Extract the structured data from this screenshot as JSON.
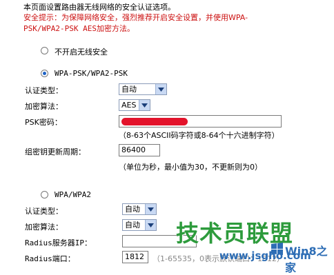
{
  "intro_line": "本页面设置路由器无线网络的安全认证选项。",
  "warning_line1": "安全提示：为保障网络安全，强烈推荐开启安全设置，并使用WPA-",
  "warning_line2": "PSK/WPA2-PSK AES加密方法。",
  "options": {
    "no_security": "不开启无线安全",
    "wpa_psk": "WPA-PSK/WPA2-PSK",
    "wpa": "WPA/WPA2"
  },
  "psk_section": {
    "auth_type_label": "认证类型：",
    "auth_type_value": "自动",
    "encryption_label": "加密算法：",
    "encryption_value": "AES",
    "psk_password_label": "PSK密码：",
    "psk_hint": "（8-63个ASCII码字符或8-64个十六进制字符）",
    "group_key_label": "组密钥更新周期：",
    "group_key_value": "86400",
    "group_key_hint": "（单位为秒，最小值为30，不更新则为0）"
  },
  "wpa_section": {
    "auth_type_label": "认证类型：",
    "auth_type_value": "自动",
    "encryption_label": "加密算法：",
    "encryption_value": "自动",
    "radius_ip_label": "Radius服务器IP：",
    "radius_port_label": "Radius端口：",
    "radius_port_value": "1812",
    "radius_port_hint": "（1-65535，0表示默认端口：1812）"
  },
  "watermark": {
    "big_text": "技术员联盟",
    "site_a": "Win8之家",
    "site_b": "www.jsgho.com"
  },
  "colors": {
    "warning": "#cc1010",
    "radio_selected": "#1e63c5",
    "watermark_green": "#2d9b3c",
    "redaction": "#e3132b"
  }
}
